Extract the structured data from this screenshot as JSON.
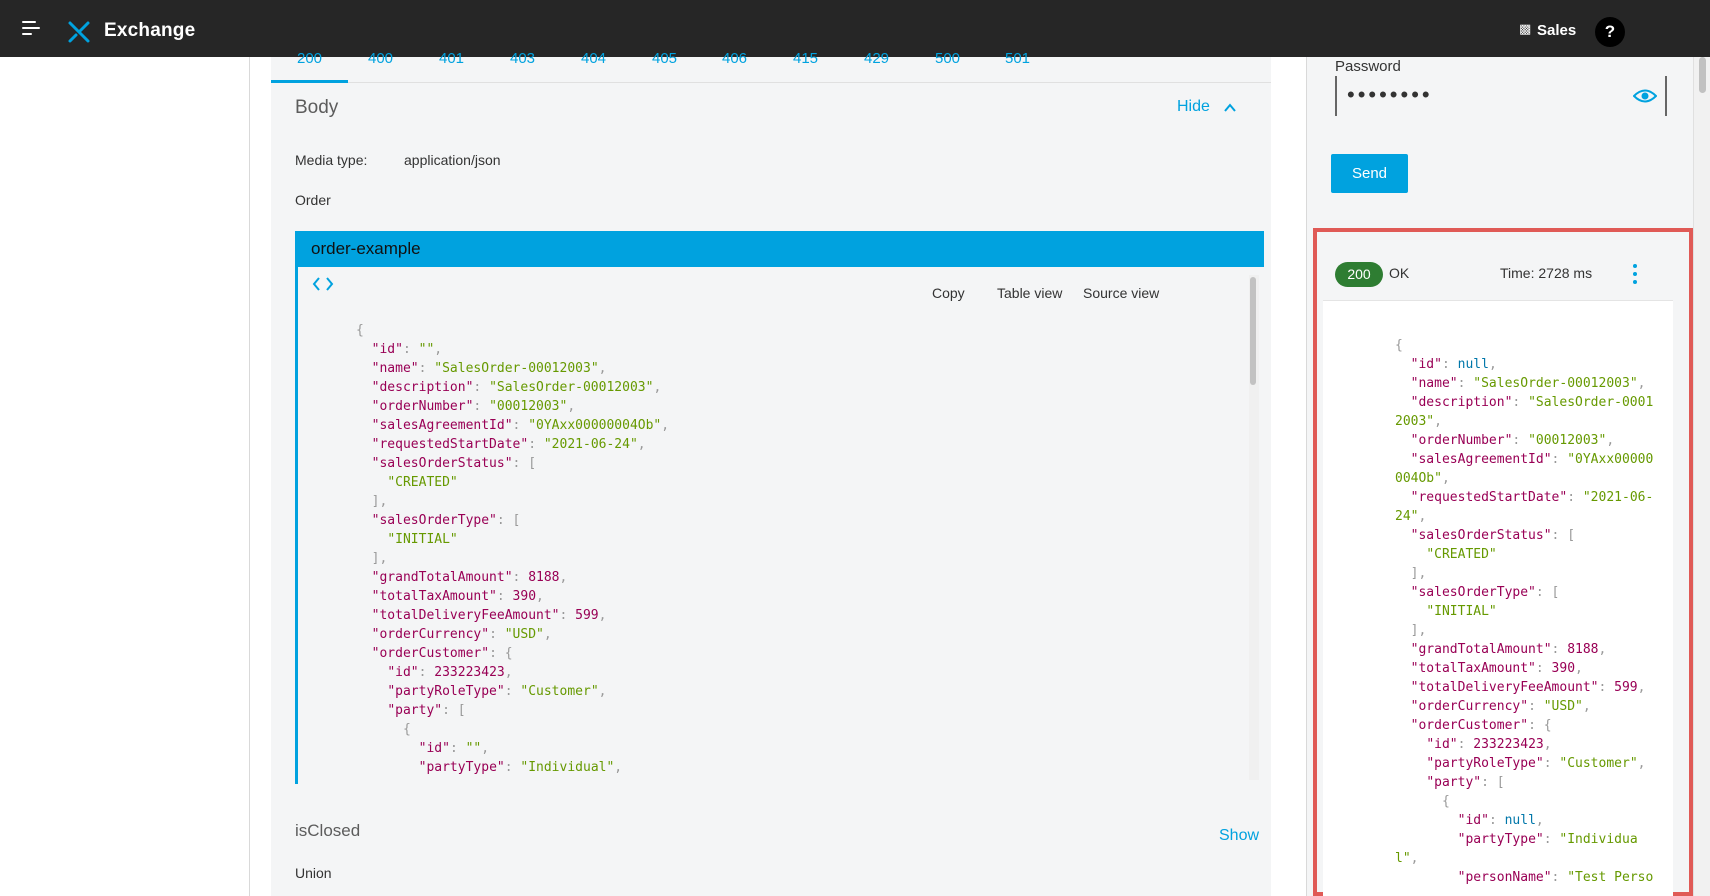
{
  "topbar": {
    "app_title": "Exchange",
    "org_name": "Sales",
    "help_label": "?",
    "menu_icon": "hamburger-menu-icon",
    "logo_icon": "exchange-logo-icon",
    "org_icon": "org-building-icon"
  },
  "tabs": [
    {
      "label": "200",
      "active": true
    },
    {
      "label": "400"
    },
    {
      "label": "401"
    },
    {
      "label": "403"
    },
    {
      "label": "404"
    },
    {
      "label": "405"
    },
    {
      "label": "406"
    },
    {
      "label": "415"
    },
    {
      "label": "429"
    },
    {
      "label": "500"
    },
    {
      "label": "501"
    }
  ],
  "body_section": {
    "title": "Body",
    "toggle_label": "Hide",
    "media_type_label": "Media type:",
    "media_type_value": "application/json",
    "type_name": "Order"
  },
  "example": {
    "title": "order-example",
    "copy_label": "Copy",
    "table_view_label": "Table view",
    "source_view_label": "Source view",
    "code_lines": [
      [
        [
          "p",
          "{"
        ]
      ],
      [
        [
          "p",
          "  "
        ],
        [
          "k",
          "\"id\""
        ],
        [
          "p",
          ": "
        ],
        [
          "s",
          "\"\""
        ],
        [
          "p",
          ","
        ]
      ],
      [
        [
          "p",
          "  "
        ],
        [
          "k",
          "\"name\""
        ],
        [
          "p",
          ": "
        ],
        [
          "s",
          "\"SalesOrder-00012003\""
        ],
        [
          "p",
          ","
        ]
      ],
      [
        [
          "p",
          "  "
        ],
        [
          "k",
          "\"description\""
        ],
        [
          "p",
          ": "
        ],
        [
          "s",
          "\"SalesOrder-00012003\""
        ],
        [
          "p",
          ","
        ]
      ],
      [
        [
          "p",
          "  "
        ],
        [
          "k",
          "\"orderNumber\""
        ],
        [
          "p",
          ": "
        ],
        [
          "s",
          "\"00012003\""
        ],
        [
          "p",
          ","
        ]
      ],
      [
        [
          "p",
          "  "
        ],
        [
          "k",
          "\"salesAgreementId\""
        ],
        [
          "p",
          ": "
        ],
        [
          "s",
          "\"0YAxx00000004Ob\""
        ],
        [
          "p",
          ","
        ]
      ],
      [
        [
          "p",
          "  "
        ],
        [
          "k",
          "\"requestedStartDate\""
        ],
        [
          "p",
          ": "
        ],
        [
          "s",
          "\"2021-06-24\""
        ],
        [
          "p",
          ","
        ]
      ],
      [
        [
          "p",
          "  "
        ],
        [
          "k",
          "\"salesOrderStatus\""
        ],
        [
          "p",
          ": ["
        ]
      ],
      [
        [
          "p",
          "    "
        ],
        [
          "s",
          "\"CREATED\""
        ]
      ],
      [
        [
          "p",
          "  ],"
        ]
      ],
      [
        [
          "p",
          "  "
        ],
        [
          "k",
          "\"salesOrderType\""
        ],
        [
          "p",
          ": ["
        ]
      ],
      [
        [
          "p",
          "    "
        ],
        [
          "s",
          "\"INITIAL\""
        ]
      ],
      [
        [
          "p",
          "  ],"
        ]
      ],
      [
        [
          "p",
          "  "
        ],
        [
          "k",
          "\"grandTotalAmount\""
        ],
        [
          "p",
          ": "
        ],
        [
          "n",
          "8188"
        ],
        [
          "p",
          ","
        ]
      ],
      [
        [
          "p",
          "  "
        ],
        [
          "k",
          "\"totalTaxAmount\""
        ],
        [
          "p",
          ": "
        ],
        [
          "n",
          "390"
        ],
        [
          "p",
          ","
        ]
      ],
      [
        [
          "p",
          "  "
        ],
        [
          "k",
          "\"totalDeliveryFeeAmount\""
        ],
        [
          "p",
          ": "
        ],
        [
          "n",
          "599"
        ],
        [
          "p",
          ","
        ]
      ],
      [
        [
          "p",
          "  "
        ],
        [
          "k",
          "\"orderCurrency\""
        ],
        [
          "p",
          ": "
        ],
        [
          "s",
          "\"USD\""
        ],
        [
          "p",
          ","
        ]
      ],
      [
        [
          "p",
          "  "
        ],
        [
          "k",
          "\"orderCustomer\""
        ],
        [
          "p",
          ": {"
        ]
      ],
      [
        [
          "p",
          "    "
        ],
        [
          "k",
          "\"id\""
        ],
        [
          "p",
          ": "
        ],
        [
          "n",
          "233223423"
        ],
        [
          "p",
          ","
        ]
      ],
      [
        [
          "p",
          "    "
        ],
        [
          "k",
          "\"partyRoleType\""
        ],
        [
          "p",
          ": "
        ],
        [
          "s",
          "\"Customer\""
        ],
        [
          "p",
          ","
        ]
      ],
      [
        [
          "p",
          "    "
        ],
        [
          "k",
          "\"party\""
        ],
        [
          "p",
          ": ["
        ]
      ],
      [
        [
          "p",
          "      {"
        ]
      ],
      [
        [
          "p",
          "        "
        ],
        [
          "k",
          "\"id\""
        ],
        [
          "p",
          ": "
        ],
        [
          "s",
          "\"\""
        ],
        [
          "p",
          ","
        ]
      ],
      [
        [
          "p",
          "        "
        ],
        [
          "k",
          "\"partyType\""
        ],
        [
          "p",
          ": "
        ],
        [
          "s",
          "\"Individual\""
        ],
        [
          "p",
          ","
        ]
      ]
    ]
  },
  "isclosed_section": {
    "title": "isClosed",
    "toggle_label": "Show",
    "type_name": "Union"
  },
  "console": {
    "password_label": "Password",
    "password_value": "••••••••",
    "send_label": "Send",
    "response": {
      "status_code": "200",
      "status_text": "OK",
      "time": "Time: 2728 ms",
      "code_lines": [
        [
          [
            "p",
            "{"
          ]
        ],
        [
          [
            "p",
            "  "
          ],
          [
            "k",
            "\"id\""
          ],
          [
            "p",
            ": "
          ],
          [
            "null",
            "null"
          ],
          [
            "p",
            ","
          ]
        ],
        [
          [
            "p",
            "  "
          ],
          [
            "k",
            "\"name\""
          ],
          [
            "p",
            ": "
          ],
          [
            "s",
            "\"SalesOrder-00012003\""
          ],
          [
            "p",
            ","
          ]
        ],
        [
          [
            "p",
            "  "
          ],
          [
            "k",
            "\"description\""
          ],
          [
            "p",
            ": "
          ],
          [
            "s",
            "\"SalesOrder-0001"
          ]
        ],
        [
          [
            "s",
            "2003\""
          ],
          [
            "p",
            ","
          ]
        ],
        [
          [
            "p",
            "  "
          ],
          [
            "k",
            "\"orderNumber\""
          ],
          [
            "p",
            ": "
          ],
          [
            "s",
            "\"00012003\""
          ],
          [
            "p",
            ","
          ]
        ],
        [
          [
            "p",
            "  "
          ],
          [
            "k",
            "\"salesAgreementId\""
          ],
          [
            "p",
            ": "
          ],
          [
            "s",
            "\"0YAxx00000"
          ]
        ],
        [
          [
            "s",
            "004Ob\""
          ],
          [
            "p",
            ","
          ]
        ],
        [
          [
            "p",
            "  "
          ],
          [
            "k",
            "\"requestedStartDate\""
          ],
          [
            "p",
            ": "
          ],
          [
            "s",
            "\"2021-06-"
          ]
        ],
        [
          [
            "s",
            "24\""
          ],
          [
            "p",
            ","
          ]
        ],
        [
          [
            "p",
            "  "
          ],
          [
            "k",
            "\"salesOrderStatus\""
          ],
          [
            "p",
            ": ["
          ]
        ],
        [
          [
            "p",
            "    "
          ],
          [
            "s",
            "\"CREATED\""
          ]
        ],
        [
          [
            "p",
            "  ],"
          ]
        ],
        [
          [
            "p",
            "  "
          ],
          [
            "k",
            "\"salesOrderType\""
          ],
          [
            "p",
            ": ["
          ]
        ],
        [
          [
            "p",
            "    "
          ],
          [
            "s",
            "\"INITIAL\""
          ]
        ],
        [
          [
            "p",
            "  ],"
          ]
        ],
        [
          [
            "p",
            "  "
          ],
          [
            "k",
            "\"grandTotalAmount\""
          ],
          [
            "p",
            ": "
          ],
          [
            "n",
            "8188"
          ],
          [
            "p",
            ","
          ]
        ],
        [
          [
            "p",
            "  "
          ],
          [
            "k",
            "\"totalTaxAmount\""
          ],
          [
            "p",
            ": "
          ],
          [
            "n",
            "390"
          ],
          [
            "p",
            ","
          ]
        ],
        [
          [
            "p",
            "  "
          ],
          [
            "k",
            "\"totalDeliveryFeeAmount\""
          ],
          [
            "p",
            ": "
          ],
          [
            "n",
            "599"
          ],
          [
            "p",
            ","
          ]
        ],
        [
          [
            "p",
            "  "
          ],
          [
            "k",
            "\"orderCurrency\""
          ],
          [
            "p",
            ": "
          ],
          [
            "s",
            "\"USD\""
          ],
          [
            "p",
            ","
          ]
        ],
        [
          [
            "p",
            "  "
          ],
          [
            "k",
            "\"orderCustomer\""
          ],
          [
            "p",
            ": {"
          ]
        ],
        [
          [
            "p",
            "    "
          ],
          [
            "k",
            "\"id\""
          ],
          [
            "p",
            ": "
          ],
          [
            "n",
            "233223423"
          ],
          [
            "p",
            ","
          ]
        ],
        [
          [
            "p",
            "    "
          ],
          [
            "k",
            "\"partyRoleType\""
          ],
          [
            "p",
            ": "
          ],
          [
            "s",
            "\"Customer\""
          ],
          [
            "p",
            ","
          ]
        ],
        [
          [
            "p",
            "    "
          ],
          [
            "k",
            "\"party\""
          ],
          [
            "p",
            ": ["
          ]
        ],
        [
          [
            "p",
            "      {"
          ]
        ],
        [
          [
            "p",
            "        "
          ],
          [
            "k",
            "\"id\""
          ],
          [
            "p",
            ": "
          ],
          [
            "null",
            "null"
          ],
          [
            "p",
            ","
          ]
        ],
        [
          [
            "p",
            "        "
          ],
          [
            "k",
            "\"partyType\""
          ],
          [
            "p",
            ": "
          ],
          [
            "s",
            "\"Individua"
          ]
        ],
        [
          [
            "s",
            "l\""
          ],
          [
            "p",
            ","
          ]
        ],
        [
          [
            "p",
            "        "
          ],
          [
            "k",
            "\"personName\""
          ],
          [
            "p",
            ": "
          ],
          [
            "s",
            "\"Test Perso"
          ]
        ]
      ]
    }
  },
  "colors": {
    "accent": "#00a2df",
    "topbar": "#262626",
    "status_ok": "#2e7d32",
    "highlight_outline": "#e05a56"
  }
}
